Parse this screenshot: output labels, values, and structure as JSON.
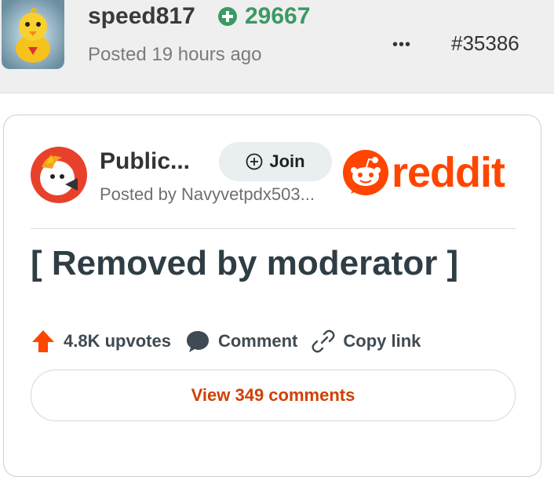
{
  "header": {
    "username": "speed817",
    "reputation": "29667",
    "posted": "Posted 19 hours ago",
    "more_menu": "•••",
    "post_id": "#35386"
  },
  "card": {
    "subreddit": "Public...",
    "posted_by": "Posted by Navyvetpdx503...",
    "join_label": "Join",
    "brand": "reddit",
    "title": "[ Removed by moderator ]",
    "actions": {
      "upvotes": "4.8K upvotes",
      "comment": "Comment",
      "copy_link": "Copy link"
    },
    "view_comments": "View 349 comments"
  },
  "colors": {
    "reddit_orange": "#ff4500",
    "rep_green": "#3a9a63",
    "view_link": "#d23f00"
  },
  "icons": [
    "plus-circle-icon",
    "more-icon",
    "subreddit-avatar",
    "join-plus-icon",
    "reddit-snoo-icon",
    "upvote-arrow-icon",
    "comment-bubble-icon",
    "link-icon"
  ]
}
